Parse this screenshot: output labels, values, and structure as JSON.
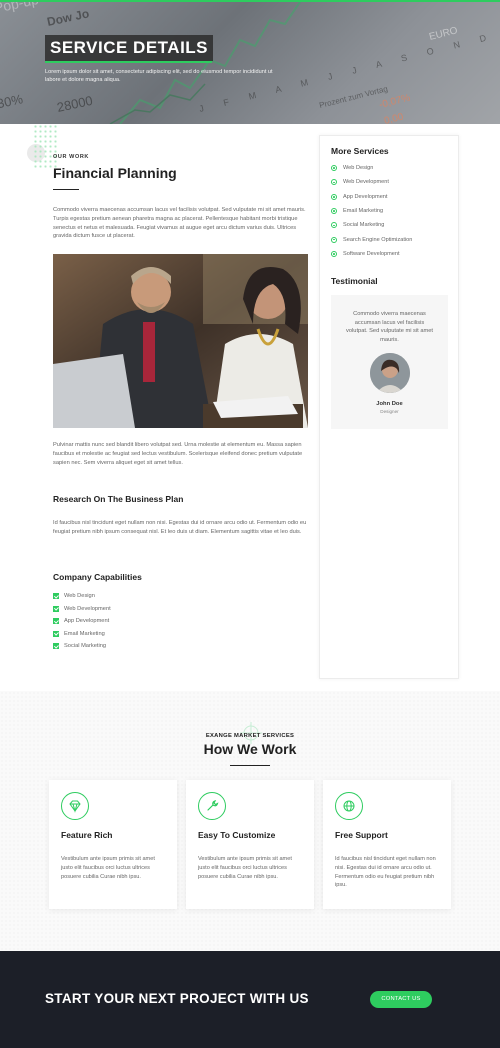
{
  "hero": {
    "title": "SERVICE DETAILS",
    "description": "Lorem ipsum dolor sit amet, consectetur adipiscing elit, sed do eiusmod tempor incididunt ut labore et dolore magna aliqua.",
    "background_text": [
      "Pop-up",
      "Dow Jo",
      "28000",
      "30%",
      "Prozent zum Vortag",
      "-0,07%",
      "0,00",
      "EURO",
      "J F M A M J J A S O N D"
    ]
  },
  "content": {
    "eyebrow": "OUR WORK",
    "title": "Financial Planning",
    "intro": "Commodo viverra maecenas accumsan lacus vel facilisis volutpat. Sed vulputate mi sit amet mauris. Turpis egestas pretium aenean pharetra magna ac placerat. Pellentesque habitant morbi tristique senectus et netus et malesuada. Feugiat vivamus at augue eget arcu dictum varius duis. Ultrices gravida dictum fusce ut placerat.",
    "after_image": "Pulvinar mattis nunc sed blandit libero volutpat sed. Urna molestie at elementum eu. Massa sapien faucibus et molestie ac feugiat sed lectus vestibulum. Scelerisque eleifend donec pretium vulputate sapien nec. Sem viverra aliquet eget sit amet tellus.",
    "research_title": "Research On The Business Plan",
    "research_text": "Id faucibus nisl tincidunt eget nullam non nisi. Egestas dui id ornare arcu odio ut. Fermentum odio eu feugiat pretium nibh ipsum consequat nisl. Et leo duis ut diam. Elementum sagittis vitae et leo duis.",
    "capabilities_title": "Company Capabilities",
    "capabilities": [
      "Web Design",
      "Web Development",
      "App Development",
      "Email Marketing",
      "Social Marketing"
    ]
  },
  "sidebar": {
    "services_title": "More Services",
    "services": [
      "Web Design",
      "Web Development",
      "App Development",
      "Email Marketing",
      "Social Marketing",
      "Search Engine Optimization",
      "Software Development"
    ],
    "testimonial_title": "Testimonial",
    "testimonial": {
      "text": "Commodo viverra maecenas accumsan lacus vel facilisis volutpat. Sed vulputate mi sit amet mauris.",
      "name": "John Doe",
      "role": "Designer"
    }
  },
  "how": {
    "eyebrow": "EXANGE MARKET SERVICES",
    "title": "How We Work",
    "cards": [
      {
        "icon": "diamond-icon",
        "title": "Feature Rich",
        "text": "Vestibulum ante ipsum primis sit amet justo elit faucibus orci luctus ultrices posuere cubilia Curae nibh ipsu."
      },
      {
        "icon": "wrench-icon",
        "title": "Easy To Customize",
        "text": "Vestibulum ante ipsum primis sit amet justo elit faucibus orci luctus ultrices posuere cubilia Curae nibh ipsu."
      },
      {
        "icon": "globe-icon",
        "title": "Free Support",
        "text": "Id faucibus nisl tincidunt eget nullam non nisi. Egestas dui id ornare arcu odio ut. Fermentum odio eu feugiat pretium nibh ipsu."
      }
    ]
  },
  "cta": {
    "title": "START YOUR NEXT PROJECT WITH US",
    "button": "CONTACT US"
  },
  "colors": {
    "accent": "#2ecc5f",
    "dark": "#1c1f28",
    "text": "#666666",
    "heading": "#222222"
  }
}
